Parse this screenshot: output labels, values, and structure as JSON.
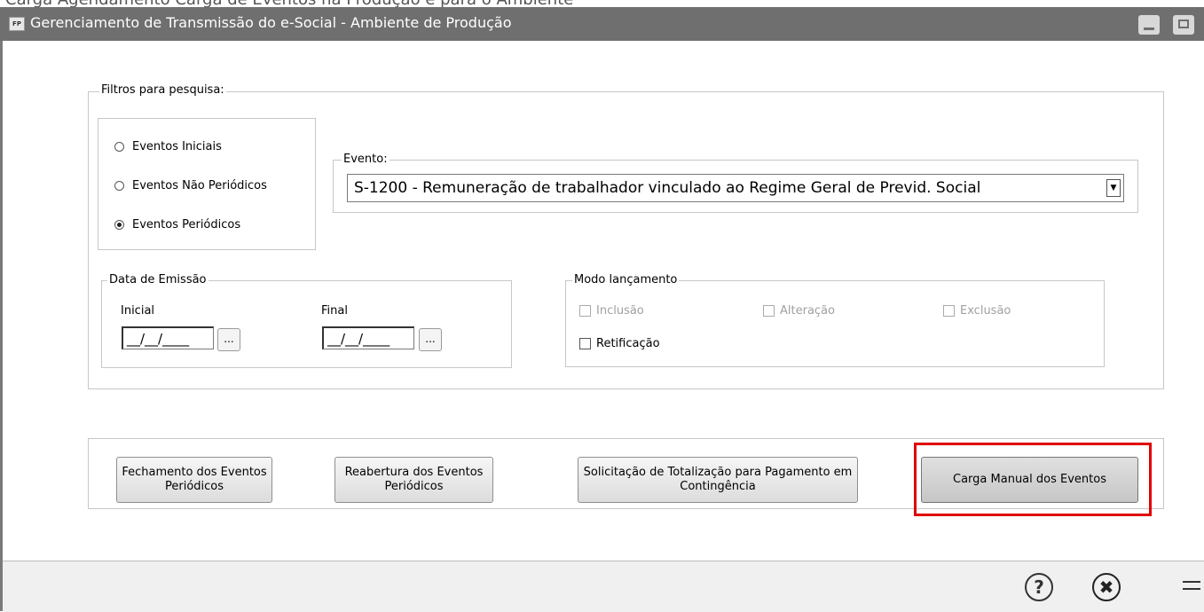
{
  "top_cropped_text": "Carga Agendamento Carga de Eventos na Produção e para o Ambiente",
  "window": {
    "app_icon": "FP",
    "title": "Gerenciamento de Transmissão do e-Social - Ambiente de Produção",
    "minimize_icon": "minimize-icon",
    "maximize_icon": "maximize-icon"
  },
  "filters": {
    "legend": "Filtros para pesquisa:",
    "event_type": {
      "options": [
        {
          "label": "Eventos Iniciais",
          "checked": false
        },
        {
          "label": "Eventos Não Periódicos",
          "checked": false
        },
        {
          "label": "Eventos Periódicos",
          "checked": true
        }
      ]
    },
    "evento": {
      "legend": "Evento:",
      "selected": "S-1200 - Remuneração de trabalhador vinculado ao Regime Geral de Previd. Social"
    },
    "data_emissao": {
      "legend": "Data de Emissão",
      "inicial_label": "Inicial",
      "inicial_value": "__/__/____",
      "final_label": "Final",
      "final_value": "__/__/____",
      "picker_label": "..."
    },
    "modo_lancamento": {
      "legend": "Modo lançamento",
      "inclusao": "Inclusão",
      "alteracao": "Alteração",
      "exclusao": "Exclusão",
      "retificacao": "Retificação"
    }
  },
  "actions": {
    "fechamento": "Fechamento dos Eventos Periódicos",
    "reabertura": "Reabertura dos Eventos Periódicos",
    "solicitacao": "Solicitação de Totalização para Pagamento em Contingência",
    "carga_manual": "Carga Manual dos Eventos"
  },
  "footer": {
    "help_icon": "help-icon",
    "close_icon": "close-icon",
    "menu_icon": "menu-icon"
  },
  "colors": {
    "titlebar": "#6f6f6f",
    "highlight": "#e00000",
    "footer": "#f0f0f0"
  }
}
